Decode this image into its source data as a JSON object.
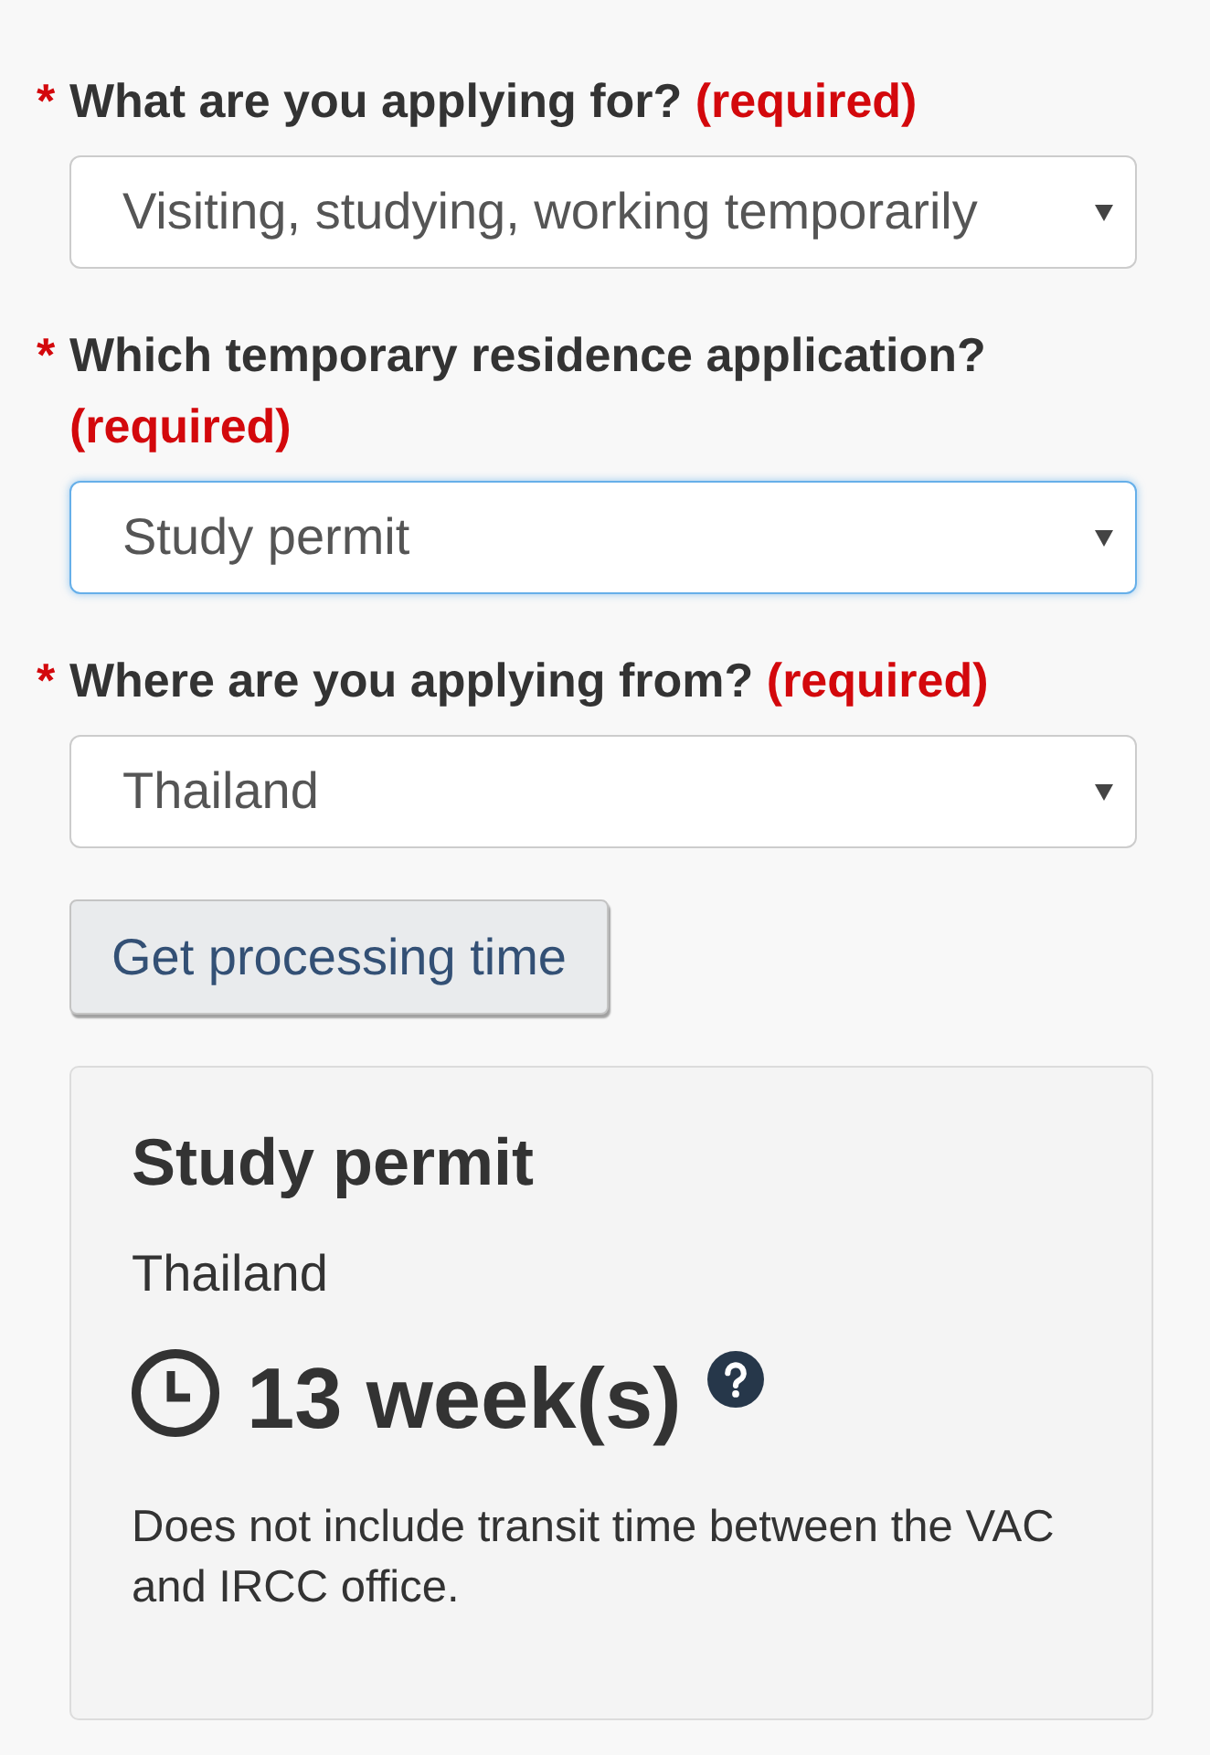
{
  "fields": [
    {
      "required_mark": "*",
      "label": "What are you applying for?",
      "required_note": "(required)",
      "value": "Visiting, studying, working temporarily",
      "focused": false
    },
    {
      "required_mark": "*",
      "label": "Which temporary residence application?",
      "required_note": "(required)",
      "value": "Study permit",
      "focused": true
    },
    {
      "required_mark": "*",
      "label": "Where are you applying from?",
      "required_note": "(required)",
      "value": "Thailand",
      "focused": false
    }
  ],
  "submit_button": {
    "label": "Get processing time"
  },
  "result": {
    "title": "Study permit",
    "country": "Thailand",
    "duration": "13 week(s)",
    "note": "Does not include transit time between the VAC and IRCC office."
  }
}
